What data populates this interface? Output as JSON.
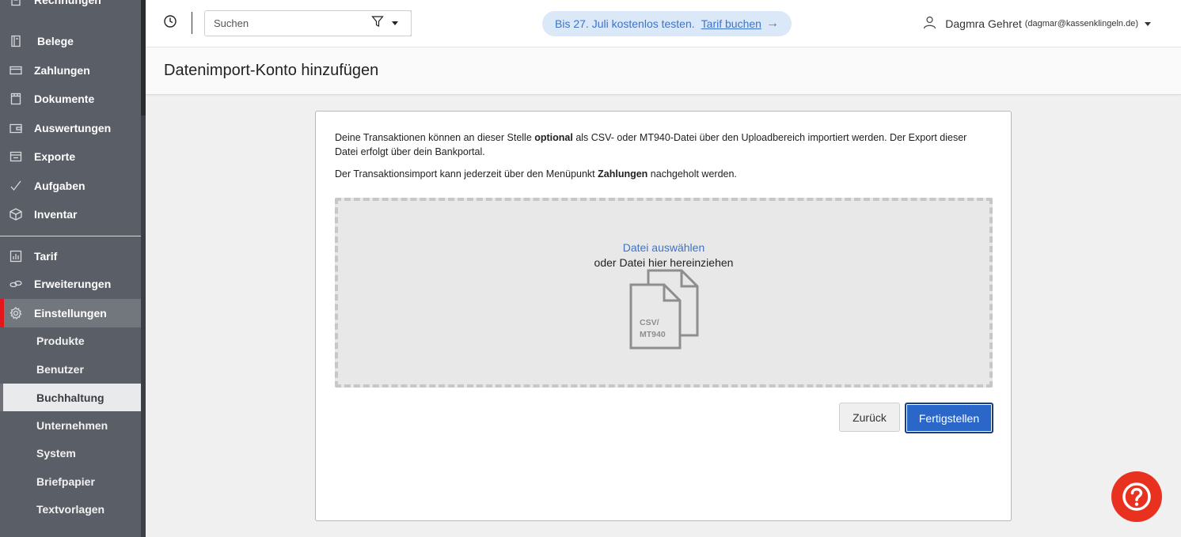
{
  "sidebar": {
    "items": [
      {
        "label": "Rechnungen",
        "icon": "invoice-icon"
      },
      {
        "label": "Belege",
        "icon": "receipt-icon"
      },
      {
        "label": "Zahlungen",
        "icon": "credit-card-icon"
      },
      {
        "label": "Dokumente",
        "icon": "document-icon"
      },
      {
        "label": "Auswertungen",
        "icon": "wallet-icon"
      },
      {
        "label": "Exporte",
        "icon": "export-tray-icon"
      },
      {
        "label": "Aufgaben",
        "icon": "checkmark-icon"
      },
      {
        "label": "Inventar",
        "icon": "box-icon"
      },
      {
        "label": "Tarif",
        "icon": "bar-chart-icon"
      },
      {
        "label": "Erweiterungen",
        "icon": "link-icon"
      },
      {
        "label": "Einstellungen",
        "icon": "gear-icon"
      }
    ],
    "subitems": [
      {
        "label": "Produkte"
      },
      {
        "label": "Benutzer"
      },
      {
        "label": "Buchhaltung"
      },
      {
        "label": "Unternehmen"
      },
      {
        "label": "System"
      },
      {
        "label": "Briefpapier"
      },
      {
        "label": "Textvorlagen"
      }
    ],
    "active_item": "Einstellungen",
    "selected_subitem": "Buchhaltung",
    "accent_color": "#e3161b"
  },
  "header": {
    "search_placeholder": "Suchen",
    "trial_text": "Bis 27. Juli kostenlos testen.",
    "trial_link": "Tarif buchen",
    "trial_arrow": "→",
    "user_name": "Dagmra Gehret",
    "user_email": "(dagmar@kassenklingeln.de)"
  },
  "page": {
    "title": "Datenimport-Konto hinzufügen"
  },
  "content": {
    "para1_part1": "Deine Transaktionen können an dieser Stelle ",
    "para1_bold": "optional",
    "para1_part2": " als CSV- oder MT940-Datei über den Uploadbereich importiert werden. Der Export dieser Datei erfolgt über dein Bankportal.",
    "para2_part1": "Der Transaktionsimport kann jederzeit über den Menüpunkt ",
    "para2_bold": "Zahlungen",
    "para2_part2": " nachgeholt werden.",
    "dropzone_link": "Datei auswählen",
    "dropzone_text": "oder Datei hier hereinziehen",
    "file_icon_label_1": "CSV/",
    "file_icon_label_2": "MT940",
    "back_button": "Zurück",
    "finish_button": "Fertigstellen"
  },
  "colors": {
    "primary": "#2b67c9",
    "sidebar_bg": "#5a5e66",
    "help_button": "#e8321f",
    "trial_bg": "#dbe8f7"
  }
}
